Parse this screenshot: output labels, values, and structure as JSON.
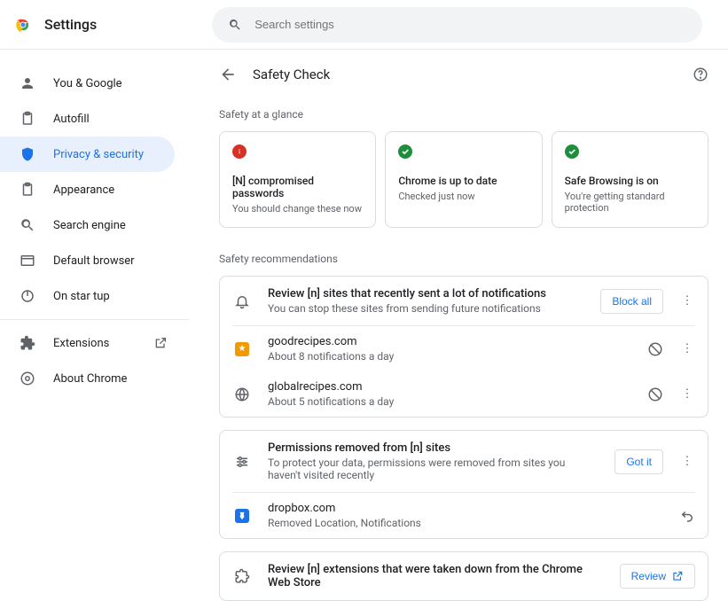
{
  "header": {
    "title": "Settings",
    "search_placeholder": "Search settings"
  },
  "sidebar": {
    "items": [
      {
        "label": "You & Google"
      },
      {
        "label": "Autofill"
      },
      {
        "label": "Privacy & security"
      },
      {
        "label": "Appearance"
      },
      {
        "label": "Search engine"
      },
      {
        "label": "Default browser"
      },
      {
        "label": "On star  tup"
      },
      {
        "label": "Extensions"
      },
      {
        "label": "About Chrome"
      }
    ]
  },
  "page": {
    "title": "Safety Check",
    "glance_label": "Safety at a glance",
    "recs_label": "Safety recommendations"
  },
  "glance": {
    "c1_t": "[N] compromised passwords",
    "c1_s": "You should change these now",
    "c2_t": "Chrome is up to date",
    "c2_s": "Checked just now",
    "c3_t": "Safe Browsing is on",
    "c3_s": "You're getting standard protection"
  },
  "rec1": {
    "title": "Review [n] sites that recently sent a lot of notifications",
    "sub": "You can stop these sites from sending future notifications",
    "btn": "Block all",
    "s1_t": "goodrecipes.com",
    "s1_s": "About 8 notifications a day",
    "s2_t": "globalrecipes.com",
    "s2_s": "About 5 notifications a day"
  },
  "rec2": {
    "title": "Permissions removed from [n] sites",
    "sub": "To protect your data, permissions were removed from sites you haven't visited recently",
    "btn": "Got it",
    "s1_t": "dropbox.com",
    "s1_s": "Removed Location, Notifications"
  },
  "rec3": {
    "title": "Review [n] extensions that were taken down from the Chrome Web Store",
    "btn": "Review"
  }
}
